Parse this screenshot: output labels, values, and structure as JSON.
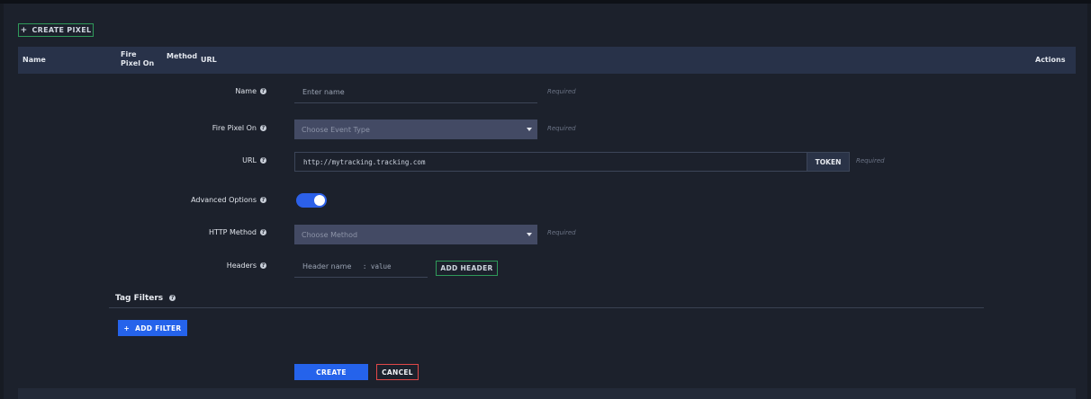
{
  "toolbar": {
    "create_pixel_label": "CREATE PIXEL",
    "plus_icon": "+"
  },
  "table": {
    "columns": [
      "Name",
      "Fire Pixel On",
      "Method",
      "URL",
      "Actions"
    ]
  },
  "form": {
    "name": {
      "label": "Name",
      "placeholder": "Enter name",
      "required": "Required"
    },
    "fire_pixel_on": {
      "label": "Fire Pixel On",
      "placeholder": "Choose Event Type",
      "required": "Required"
    },
    "url": {
      "label": "URL",
      "value": "http://mytracking.tracking.com",
      "token_label": "TOKEN",
      "required": "Required"
    },
    "advanced": {
      "label": "Advanced Options",
      "enabled": true
    },
    "http_method": {
      "label": "HTTP Method",
      "placeholder": "Choose Method",
      "required": "Required"
    },
    "headers": {
      "label": "Headers",
      "name_placeholder": "Header name",
      "value_placeholder": ": value",
      "add_label": "ADD HEADER"
    },
    "tag_filters": {
      "title": "Tag Filters",
      "add_label": "ADD FILTER"
    },
    "create_label": "CREATE",
    "cancel_label": "CANCEL"
  },
  "help_glyph": "?",
  "colors": {
    "accent_blue": "#2563eb",
    "accent_green": "#2f9a5a",
    "danger": "#e14848",
    "header_bg": "#283249"
  }
}
